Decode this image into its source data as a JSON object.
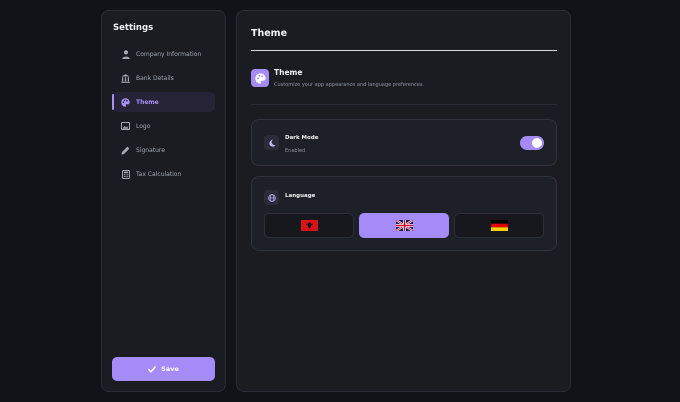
{
  "sidebar": {
    "title": "Settings",
    "items": [
      {
        "label": "Company Information",
        "icon": "user-icon"
      },
      {
        "label": "Bank Details",
        "icon": "bank-icon"
      },
      {
        "label": "Theme",
        "icon": "palette-icon",
        "active": true
      },
      {
        "label": "Logo",
        "icon": "image-icon"
      },
      {
        "label": "Signature",
        "icon": "pen-icon"
      },
      {
        "label": "Tax Calculation",
        "icon": "calculator-icon"
      }
    ],
    "save_label": "Save"
  },
  "main": {
    "title": "Theme",
    "section": {
      "title": "Theme",
      "description": "Customize your app appearance and language preferences."
    },
    "dark_mode": {
      "label": "Dark Mode",
      "status": "Enabled",
      "enabled": true
    },
    "language": {
      "label": "Language",
      "options": [
        {
          "flag": "albania-flag-icon",
          "selected": false
        },
        {
          "flag": "uk-flag-icon",
          "selected": true
        },
        {
          "flag": "germany-flag-icon",
          "selected": false
        }
      ]
    }
  },
  "colors": {
    "accent": "#a58bf7",
    "background": "#111318",
    "panel": "#1a1c22"
  }
}
